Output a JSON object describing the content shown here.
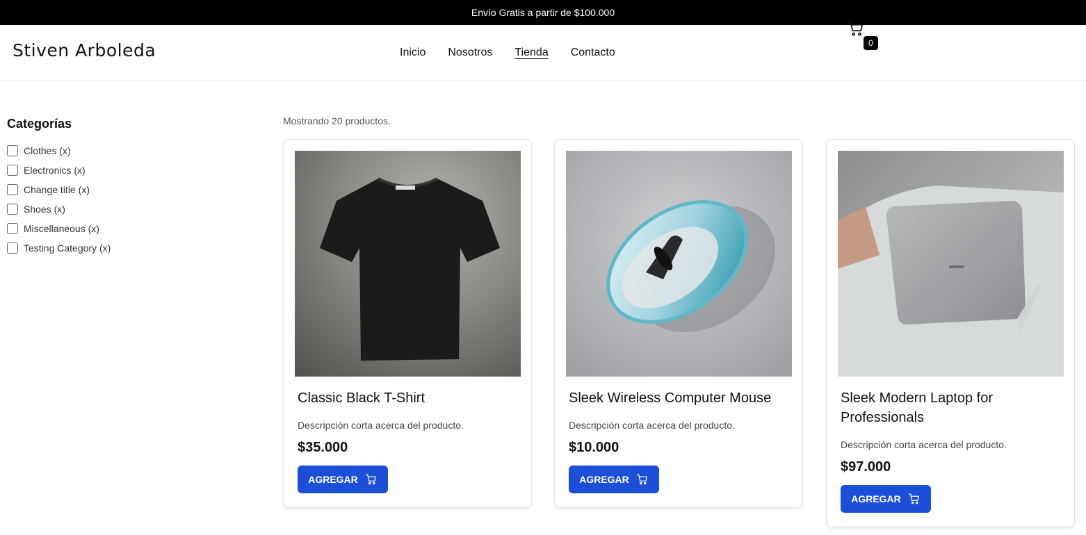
{
  "announcement": "Envío Gratis a partir de $100.000",
  "brand": {
    "logo_text": "Stiven Arboleda",
    "accent_color": "#22b3c6"
  },
  "nav": {
    "items": [
      {
        "label": "Inicio"
      },
      {
        "label": "Nosotros"
      },
      {
        "label": "Tienda",
        "active": true
      },
      {
        "label": "Contacto"
      }
    ]
  },
  "cart": {
    "icon": "cart-icon",
    "count": "0"
  },
  "sidebar": {
    "title": "Categorías",
    "categories": [
      {
        "label": "Clothes (x)"
      },
      {
        "label": "Electronics (x)"
      },
      {
        "label": "Change title (x)"
      },
      {
        "label": "Shoes (x)"
      },
      {
        "label": "Miscellaneous (x)"
      },
      {
        "label": "Testing Category (x)"
      }
    ]
  },
  "products_summary": "Mostrando 20 productos.",
  "products": [
    {
      "title": "Classic Black T-Shirt",
      "description": "Descripción corta acerca del producto.",
      "price": "$35.000",
      "button": "AGREGAR",
      "image": "black-tshirt"
    },
    {
      "title": "Sleek Wireless Computer Mouse",
      "description": "Descripción corta acerca del producto.",
      "price": "$10.000",
      "button": "AGREGAR",
      "image": "wireless-mouse"
    },
    {
      "title": "Sleek Modern Laptop for Professionals",
      "description": "Descripción corta acerca del producto.",
      "price": "$97.000",
      "button": "AGREGAR",
      "image": "laptop"
    }
  ],
  "colors": {
    "primary_button": "#1d4ed8",
    "topbar": "#000000"
  }
}
